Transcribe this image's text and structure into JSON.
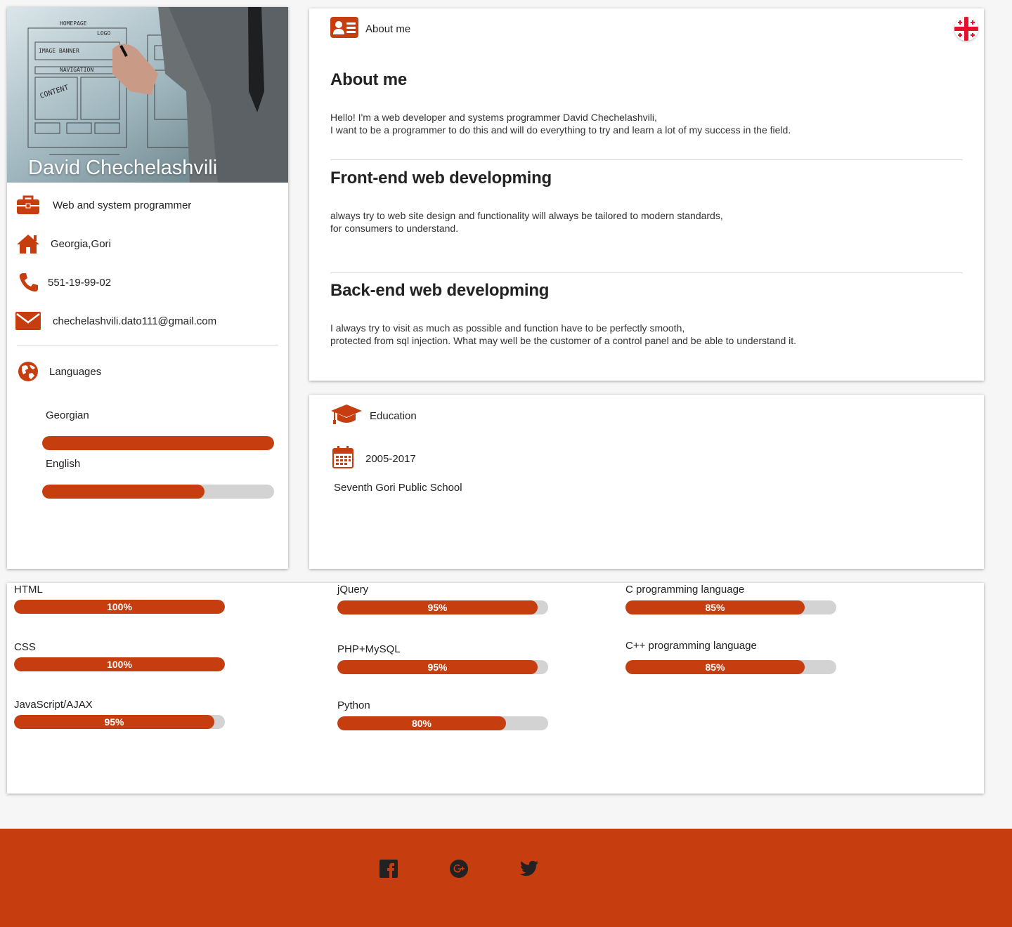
{
  "profile": {
    "name": "David Chechelashvili",
    "hero_sketch": [
      "HOMEPAGE",
      "LOGO",
      "IMAGE BANNER",
      "NAVIGATION",
      "CONTENT"
    ],
    "job": "Web and system programmer",
    "location": "Georgia,Gori",
    "phone": "551-19-99-02",
    "email": "chechelashvili.dato111@gmail.com",
    "languages_title": "Languages",
    "languages": [
      {
        "name": "Georgian",
        "level": 1.0
      },
      {
        "name": "English",
        "level": 0.7
      }
    ]
  },
  "about": {
    "header_label": "About me",
    "sections": [
      {
        "title": "About me",
        "lines": [
          "Hello! I'm a web developer and systems programmer David Chechelashvili,",
          "I want to be a programmer to do this and will do everything to try and learn a lot of my success in the field."
        ]
      },
      {
        "title": "Front-end web developming",
        "lines": [
          "always try to web site design and functionality will always be tailored to modern standards,",
          "for consumers to understand."
        ]
      },
      {
        "title": "Back-end web developming",
        "lines": [
          "I always try to visit as much as possible and function have to be perfectly smooth,",
          "protected from sql injection. What may well be the customer of a control panel and be able to understand it."
        ]
      }
    ]
  },
  "education": {
    "header_label": "Education",
    "period": "2005-2017",
    "school": "Seventh Gori Public School"
  },
  "skills": [
    {
      "name": "HTML",
      "percent": 100,
      "label": "100%"
    },
    {
      "name": "CSS",
      "percent": 100,
      "label": "100%"
    },
    {
      "name": "JavaScript/AJAX",
      "percent": 95,
      "label": "95%"
    },
    {
      "name": "jQuery",
      "percent": 95,
      "label": "95%"
    },
    {
      "name": "PHP+MySQL",
      "percent": 95,
      "label": "95%"
    },
    {
      "name": "Python",
      "percent": 80,
      "label": "80%"
    },
    {
      "name": "C programming language",
      "percent": 85,
      "label": "85%"
    },
    {
      "name": "C++ programming language",
      "percent": 85,
      "label": "85%"
    }
  ],
  "colors": {
    "accent": "#c63d10",
    "track": "#d3d3d3",
    "background": "#f6f6f6"
  },
  "icons": [
    "briefcase-icon",
    "home-icon",
    "phone-icon",
    "envelope-icon",
    "globe-icon",
    "id-card-icon",
    "georgia-flag-icon",
    "graduation-cap-icon",
    "calendar-icon",
    "facebook-icon",
    "google-plus-icon",
    "twitter-icon"
  ]
}
